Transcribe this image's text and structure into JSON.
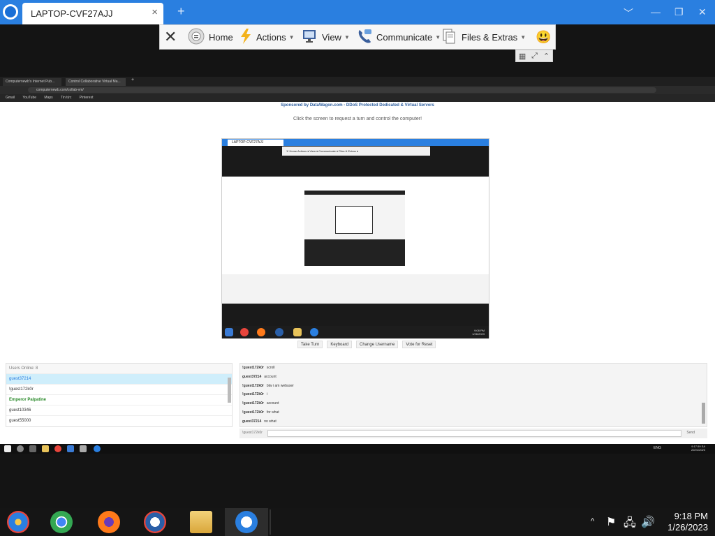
{
  "window": {
    "tab_title": "LAPTOP-CVF27AJJ",
    "tab_close": "×",
    "new_tab": "+",
    "minimize": "﹀",
    "restore": "—",
    "maximize": "❐",
    "close": "✕"
  },
  "toolbar": {
    "close": "✕",
    "home": "Home",
    "actions": "Actions",
    "view": "View",
    "communicate": "Communicate",
    "files_extras": "Files & Extras",
    "emoji": "😃"
  },
  "remote": {
    "browser_tabs": [
      "Computernewb's Internet Pub...",
      "Control Collaborative Virtual Ma..."
    ],
    "url": "computernewb.com/collab-vm/",
    "bookmarks": [
      "Gmail",
      "YouTube",
      "Maps",
      "Tin tức",
      "Pinterest"
    ],
    "sponsored": "Sponsored by DataWagon.com - DDoS Protected Dedicated & Virtual Servers",
    "instruction": "Click the screen to request a turn and control the computer!",
    "nested_title": "LAPTOP-CVF27AJJ",
    "nested_toolbar": "✕  Home   Actions ▾   View ▾   Communicate ▾   Files & Extras ▾",
    "nested_clock_time": "9:08 PM",
    "nested_clock_date": "1/26/2023",
    "buttons": [
      "Take Turn",
      "Keyboard",
      "Change Username",
      "Vote for Reset"
    ],
    "users_header": "Users Online: 8",
    "users": [
      "guest37214",
      "!guest172k0r",
      "Emperor Palpatine",
      "guest10346",
      "guest55000"
    ],
    "chat": [
      {
        "user": "!guest172k0r",
        "msg": "scroll"
      },
      {
        "user": "guest37214",
        "msg": "account"
      },
      {
        "user": "!guest172k0r",
        "msg": "btw i am webuser"
      },
      {
        "user": "!guest172k0r",
        "msg": "i"
      },
      {
        "user": "!guest172k0r",
        "msg": "account"
      },
      {
        "user": "!guest172k0r",
        "msg": "for what"
      },
      {
        "user": "guest37214",
        "msg": "no what"
      }
    ],
    "chat_nick": "!guest172k0r",
    "chat_send": "Send",
    "remote_clock_time": "9:17:59 SA",
    "remote_clock_date": "22/01/2023",
    "remote_lang": "ENG"
  },
  "taskbar": {
    "time": "9:18 PM",
    "date": "1/26/2023",
    "icons": [
      "explorer-icon",
      "chrome-icon",
      "firefox-icon",
      "obama-icon",
      "file-manager-icon",
      "teamviewer-icon"
    ]
  },
  "colors": {
    "teamviewer_blue": "#2a7fe0",
    "taskbar": "#151515"
  }
}
